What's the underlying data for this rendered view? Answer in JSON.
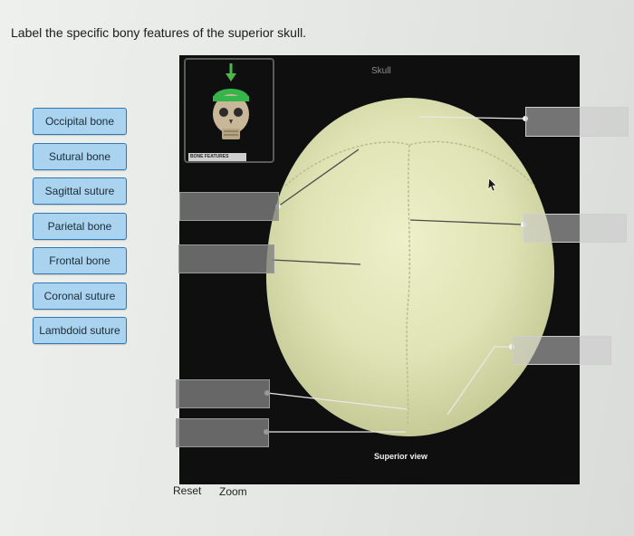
{
  "question": "Label the specific bony features of the superior skull.",
  "labels": [
    "Occipital bone",
    "Sutural bone",
    "Sagittal suture",
    "Parietal bone",
    "Frontal bone",
    "Coronal suture",
    "Lambdoid suture"
  ],
  "figure": {
    "title": "Skull",
    "caption": "Superior view",
    "thumbnail_label": "BONE FEATURES"
  },
  "controls": {
    "reset": "Reset",
    "zoom": "Zoom"
  },
  "colors": {
    "chip_fill": "#a9d3ee",
    "chip_border": "#2f78b5",
    "skull": "#dfe3b4",
    "cursor_arrow": "cursor-arrow-icon"
  }
}
